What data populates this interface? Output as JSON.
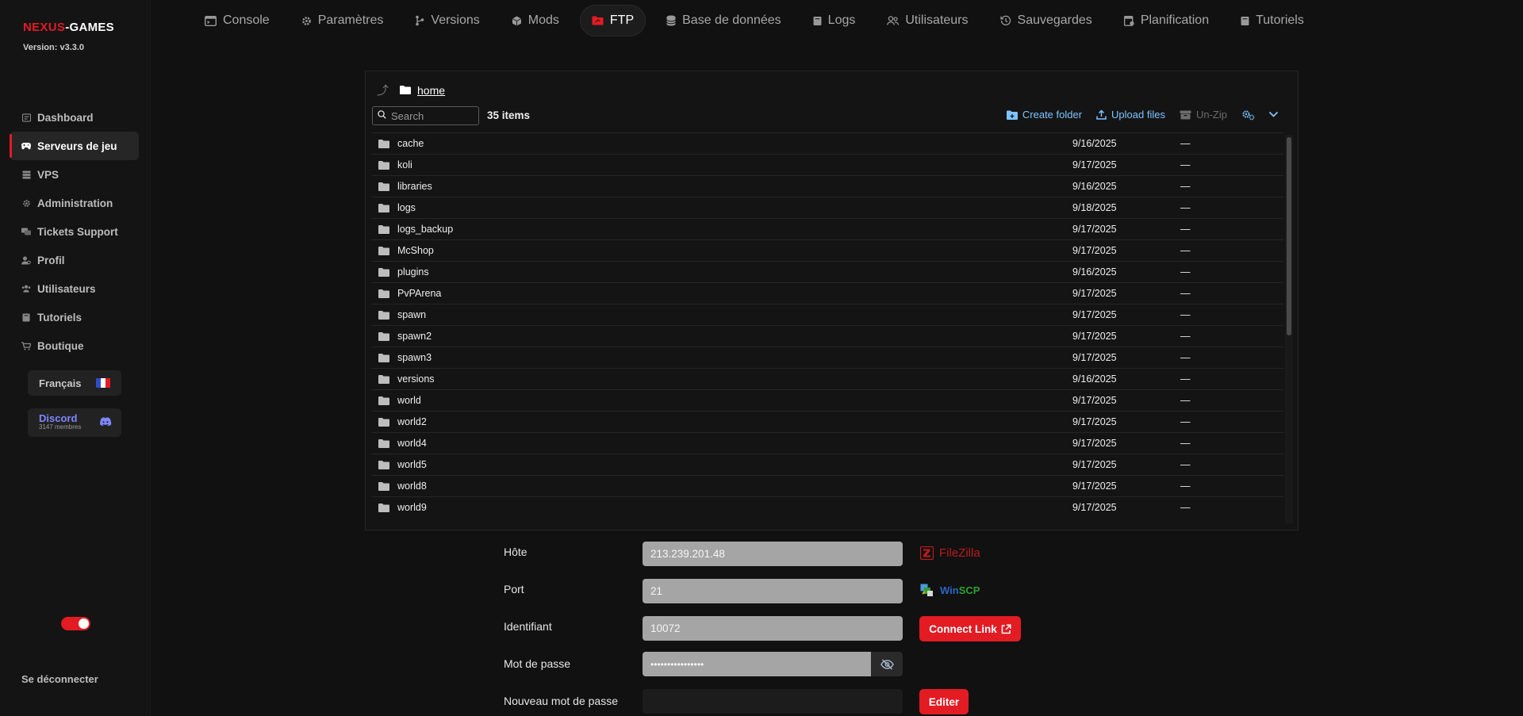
{
  "sidebar": {
    "logo_part1": "NEXUS",
    "logo_part2": "-GAMES",
    "version": "Version: v3.3.0",
    "items": [
      {
        "label": "Dashboard",
        "icon": "dashboard-icon"
      },
      {
        "label": "Serveurs de jeu",
        "icon": "gamepad-icon"
      },
      {
        "label": "VPS",
        "icon": "server-icon"
      },
      {
        "label": "Administration",
        "icon": "gear-icon"
      },
      {
        "label": "Tickets Support",
        "icon": "ticket-icon"
      },
      {
        "label": "Profil",
        "icon": "user-gear-icon"
      },
      {
        "label": "Utilisateurs",
        "icon": "users-icon"
      },
      {
        "label": "Tutoriels",
        "icon": "book-icon"
      },
      {
        "label": "Boutique",
        "icon": "cart-icon"
      }
    ],
    "language": "Français",
    "discord_label": "Discord",
    "discord_members": "3147 membres",
    "logout": "Se déconnecter"
  },
  "tabs": [
    {
      "label": "Console",
      "icon": "terminal-icon"
    },
    {
      "label": "Paramètres",
      "icon": "gear-icon"
    },
    {
      "label": "Versions",
      "icon": "branch-icon"
    },
    {
      "label": "Mods",
      "icon": "cube-icon"
    },
    {
      "label": "FTP",
      "icon": "folder-icon"
    },
    {
      "label": "Base de données",
      "icon": "database-icon"
    },
    {
      "label": "Logs",
      "icon": "book-icon"
    },
    {
      "label": "Utilisateurs",
      "icon": "users-icon"
    },
    {
      "label": "Sauvegardes",
      "icon": "history-icon"
    },
    {
      "label": "Planification",
      "icon": "calendar-icon"
    },
    {
      "label": "Tutoriels",
      "icon": "book-icon"
    }
  ],
  "file_manager": {
    "path": "home",
    "search_placeholder": "Search",
    "items_count": "35 items",
    "create_folder": "Create folder",
    "upload_files": "Upload files",
    "unzip": "Un-Zip",
    "rows": [
      {
        "name": "cache",
        "date": "9/16/2025",
        "size": "—"
      },
      {
        "name": "koli",
        "date": "9/17/2025",
        "size": "—"
      },
      {
        "name": "libraries",
        "date": "9/16/2025",
        "size": "—"
      },
      {
        "name": "logs",
        "date": "9/18/2025",
        "size": "—"
      },
      {
        "name": "logs_backup",
        "date": "9/17/2025",
        "size": "—"
      },
      {
        "name": "McShop",
        "date": "9/17/2025",
        "size": "—"
      },
      {
        "name": "plugins",
        "date": "9/16/2025",
        "size": "—"
      },
      {
        "name": "PvPArena",
        "date": "9/17/2025",
        "size": "—"
      },
      {
        "name": "spawn",
        "date": "9/17/2025",
        "size": "—"
      },
      {
        "name": "spawn2",
        "date": "9/17/2025",
        "size": "—"
      },
      {
        "name": "spawn3",
        "date": "9/17/2025",
        "size": "—"
      },
      {
        "name": "versions",
        "date": "9/16/2025",
        "size": "—"
      },
      {
        "name": "world",
        "date": "9/17/2025",
        "size": "—"
      },
      {
        "name": "world2",
        "date": "9/17/2025",
        "size": "—"
      },
      {
        "name": "world4",
        "date": "9/17/2025",
        "size": "—"
      },
      {
        "name": "world5",
        "date": "9/17/2025",
        "size": "—"
      },
      {
        "name": "world8",
        "date": "9/17/2025",
        "size": "—"
      },
      {
        "name": "world9",
        "date": "9/17/2025",
        "size": "—"
      }
    ]
  },
  "ftp": {
    "host_label": "Hôte",
    "host_value": "213.239.201.48",
    "port_label": "Port",
    "port_value": "21",
    "user_label": "Identifiant",
    "user_value": "10072",
    "password_label": "Mot de passe",
    "password_value": "••••••••••••••••",
    "new_password_label": "Nouveau mot de passe",
    "new_password_value": "",
    "filezilla": "FileZilla",
    "winscp_part1": "Win",
    "winscp_part2": "SCP",
    "connect_link": "Connect Link",
    "edit": "Editer"
  },
  "colors": {
    "accent": "#e31b23",
    "link": "#7cc4ff",
    "discord": "#7d87ff"
  }
}
